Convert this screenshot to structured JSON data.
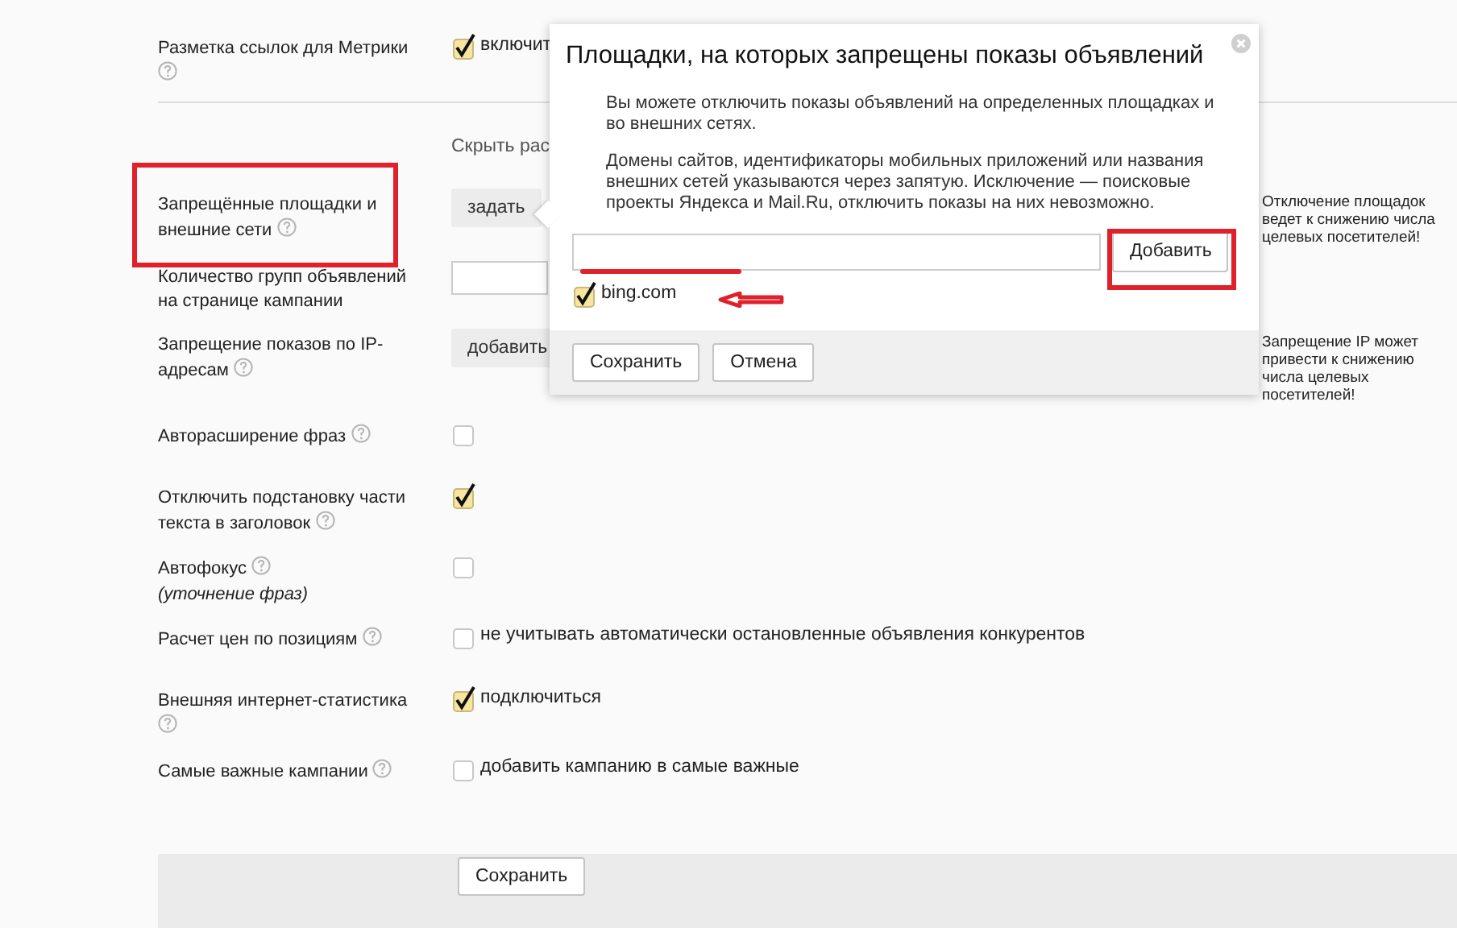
{
  "top_setting": {
    "label": "Разметка ссылок для Метрики",
    "help": true,
    "checked": true,
    "option": "включит"
  },
  "settings": [
    {
      "kind": "link",
      "link": "Скрыть рас"
    },
    {
      "kind": "button",
      "label": "Запрещённые площадки и внешние сети",
      "help": true,
      "button": "задать",
      "hint": "Отключение площадок ведет к снижению числа целевых посетителей!"
    },
    {
      "kind": "input",
      "label": "Количество групп объявлений на странице кампании",
      "help": false
    },
    {
      "kind": "button",
      "label": "Запрещение показов по IP-адресам",
      "help": true,
      "button": "добавить",
      "hint": "Запрещение IP может привести к снижению числа целевых посетителей!"
    },
    {
      "kind": "checkbox",
      "label": "Авторасширение фраз",
      "help": true,
      "checked": false
    },
    {
      "kind": "checkbox",
      "label": "Отключить подстановку части текста в заголовок",
      "help": true,
      "checked": true
    },
    {
      "kind": "checkbox",
      "label": "Автофокус",
      "sublabel": "(уточнение фраз)",
      "help": true,
      "checked": false
    },
    {
      "kind": "checkbox",
      "label": "Расчет цен по позициям",
      "help": true,
      "checked": false,
      "option": "не учитывать автоматически остановленные объявления конкурентов"
    },
    {
      "kind": "checkbox",
      "label": "Внешняя интернет-статистика",
      "help": true,
      "checked": true,
      "option": "подключиться"
    },
    {
      "kind": "checkbox",
      "label": "Самые важные кампании",
      "help": true,
      "checked": false,
      "option": "добавить кампанию в самые важные"
    }
  ],
  "save_button": "Сохранить",
  "dialog": {
    "title": "Площадки, на которых запрещены показы объявлений",
    "paragraphs": [
      "Вы можете отключить показы объявлений на определенных площадках и во внешних сетях.",
      "Домены сайтов, идентификаторы мобильных приложений или названия внешних сетей указываются через запятую. Исключение — поисковые проекты Яндекса и Mail.Ru, отключить показы на них невозможно."
    ],
    "add_button": "Добавить",
    "items": [
      {
        "label": "bing.com",
        "checked": true
      }
    ],
    "buttons": [
      "Сохранить",
      "Отмена"
    ]
  }
}
